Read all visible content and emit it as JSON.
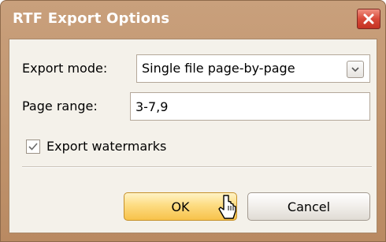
{
  "window": {
    "title": "RTF Export Options",
    "close_icon": "close-icon"
  },
  "form": {
    "export_mode_label": "Export mode:",
    "export_mode_value": "Single file page-by-page",
    "page_range_label": "Page range:",
    "page_range_value": "3-7,9",
    "watermarks_label": "Export watermarks",
    "watermarks_checked": true
  },
  "buttons": {
    "ok_label": "OK",
    "cancel_label": "Cancel"
  },
  "colors": {
    "title_bar": "#c9a07c",
    "close_button": "#d84a3a",
    "ok_button": "#fddc82"
  }
}
